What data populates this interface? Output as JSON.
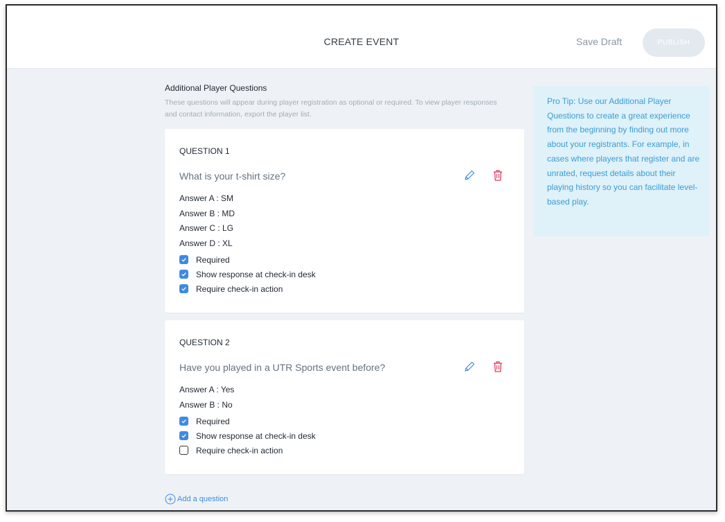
{
  "header": {
    "title": "CREATE EVENT",
    "save_draft": "Save Draft",
    "publish": "PUBLISH"
  },
  "section": {
    "title": "Additional Player Questions",
    "description": "These questions will appear during player registration as optional or required. To view player responses and contact information, export the player list."
  },
  "questions": [
    {
      "label": "QUESTION 1",
      "text": "What is your t-shirt size?",
      "answers": [
        "Answer A : SM",
        "Answer B : MD",
        "Answer C : LG",
        "Answer D : XL"
      ],
      "options": [
        {
          "label": "Required",
          "checked": true
        },
        {
          "label": "Show response at check-in desk",
          "checked": true
        },
        {
          "label": "Require check-in action",
          "checked": true
        }
      ]
    },
    {
      "label": "QUESTION 2",
      "text": "Have you played in a UTR Sports event before?",
      "answers": [
        "Answer A : Yes",
        "Answer B : No"
      ],
      "options": [
        {
          "label": "Required",
          "checked": true
        },
        {
          "label": "Show response at check-in desk",
          "checked": true
        },
        {
          "label": "Require check-in action",
          "checked": false
        }
      ]
    }
  ],
  "tip": {
    "text": "Pro Tip: Use our Additional Player Questions to create a great experience from the beginning by finding out more about your registrants. For example, in cases where players that register and are unrated, request details about their playing history so you can facilitate level-based play."
  },
  "add_question": "Add a question",
  "icons": {
    "edit": "pencil-icon",
    "delete": "trash-icon",
    "add": "plus-circle-icon",
    "check": "check-icon"
  },
  "colors": {
    "accent": "#3f8ae0",
    "delete": "#e0375e",
    "tip_bg": "#dff1f9",
    "tip_text": "#3a9dd2"
  }
}
